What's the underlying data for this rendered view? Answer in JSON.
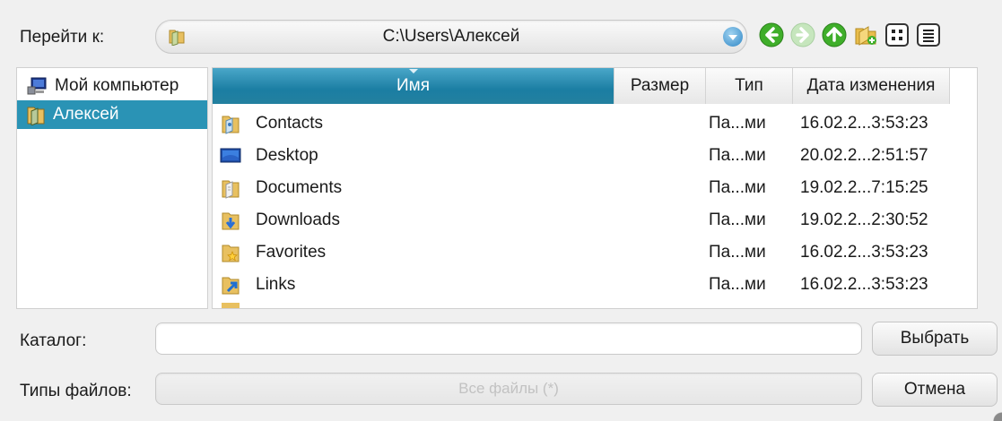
{
  "nav": {
    "goto_label": "Перейти к:",
    "path": "C:\\Users\\Алексей",
    "buttons": [
      "back-icon",
      "forward-icon",
      "up-icon",
      "new-folder-icon",
      "icon-view-icon",
      "list-view-icon"
    ]
  },
  "sidebar": {
    "items": [
      {
        "label": "Мой компьютер",
        "icon": "computer-icon",
        "selected": false
      },
      {
        "label": "Алексей",
        "icon": "user-folder-icon",
        "selected": true
      }
    ]
  },
  "columns": {
    "name": "Имя",
    "size": "Размер",
    "type": "Тип",
    "date": "Дата изменения"
  },
  "files": [
    {
      "name": "Contacts",
      "size": "",
      "type": "Па...ми",
      "date": "16.02.2...3:53:23",
      "icon": "contacts-folder-icon"
    },
    {
      "name": "Desktop",
      "size": "",
      "type": "Па...ми",
      "date": "20.02.2...2:51:57",
      "icon": "desktop-folder-icon"
    },
    {
      "name": "Documents",
      "size": "",
      "type": "Па...ми",
      "date": "19.02.2...7:15:25",
      "icon": "documents-folder-icon"
    },
    {
      "name": "Downloads",
      "size": "",
      "type": "Па...ми",
      "date": "19.02.2...2:30:52",
      "icon": "downloads-folder-icon"
    },
    {
      "name": "Favorites",
      "size": "",
      "type": "Па...ми",
      "date": "16.02.2...3:53:23",
      "icon": "favorites-folder-icon"
    },
    {
      "name": "Links",
      "size": "",
      "type": "Па...ми",
      "date": "16.02.2...3:53:23",
      "icon": "links-folder-icon"
    }
  ],
  "bottom": {
    "catalog_label": "Каталог:",
    "catalog_value": "",
    "select_button": "Выбрать",
    "filetypes_label": "Типы файлов:",
    "filetypes_value": "Все файлы (*)",
    "cancel_button": "Отмена"
  },
  "colors": {
    "accent": "#2a93b5",
    "header_active": "#1b7ea3"
  }
}
